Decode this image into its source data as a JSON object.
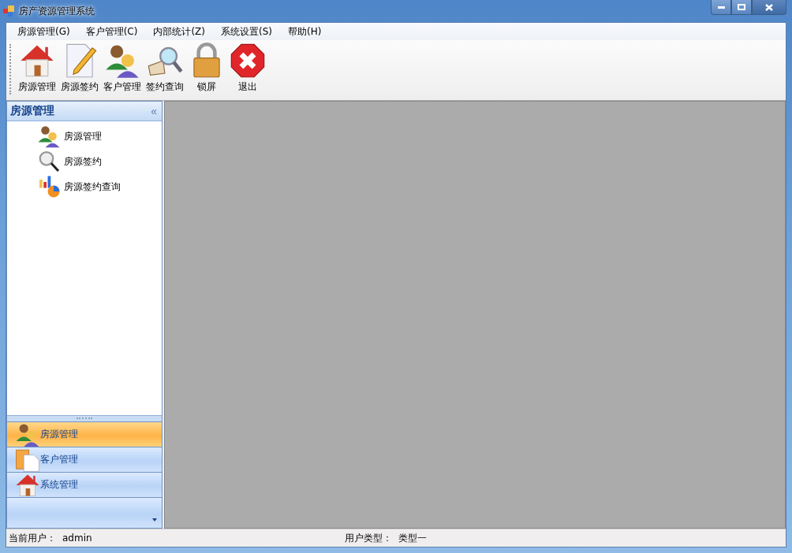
{
  "window": {
    "title": "房产资源管理系统"
  },
  "menu": [
    {
      "label": "房源管理(G)"
    },
    {
      "label": "客户管理(C)"
    },
    {
      "label": "内部统计(Z)"
    },
    {
      "label": "系统设置(S)"
    },
    {
      "label": "帮助(H)"
    }
  ],
  "toolbar": [
    {
      "label": "房源管理",
      "kind": "house"
    },
    {
      "label": "房源签约",
      "kind": "document"
    },
    {
      "label": "客户管理",
      "kind": "people"
    },
    {
      "label": "签约查询",
      "kind": "booksearch"
    },
    {
      "label": "锁屏",
      "kind": "lock"
    },
    {
      "label": "退出",
      "kind": "exit"
    }
  ],
  "sidebar": {
    "title": "房源管理",
    "collapse": "«",
    "items": [
      {
        "label": "房源管理",
        "kind": "people"
      },
      {
        "label": "房源签约",
        "kind": "magnifier"
      },
      {
        "label": "房源签约查询",
        "kind": "chart"
      }
    ],
    "nav": [
      {
        "label": "房源管理",
        "kind": "people",
        "selected": true
      },
      {
        "label": "客户管理",
        "kind": "clipboard",
        "selected": false
      },
      {
        "label": "系统管理",
        "kind": "house",
        "selected": false
      }
    ]
  },
  "status_bar": {
    "user_label": "当前用户：",
    "user": "admin",
    "type_label": "用户类型：",
    "type": "类型一"
  }
}
